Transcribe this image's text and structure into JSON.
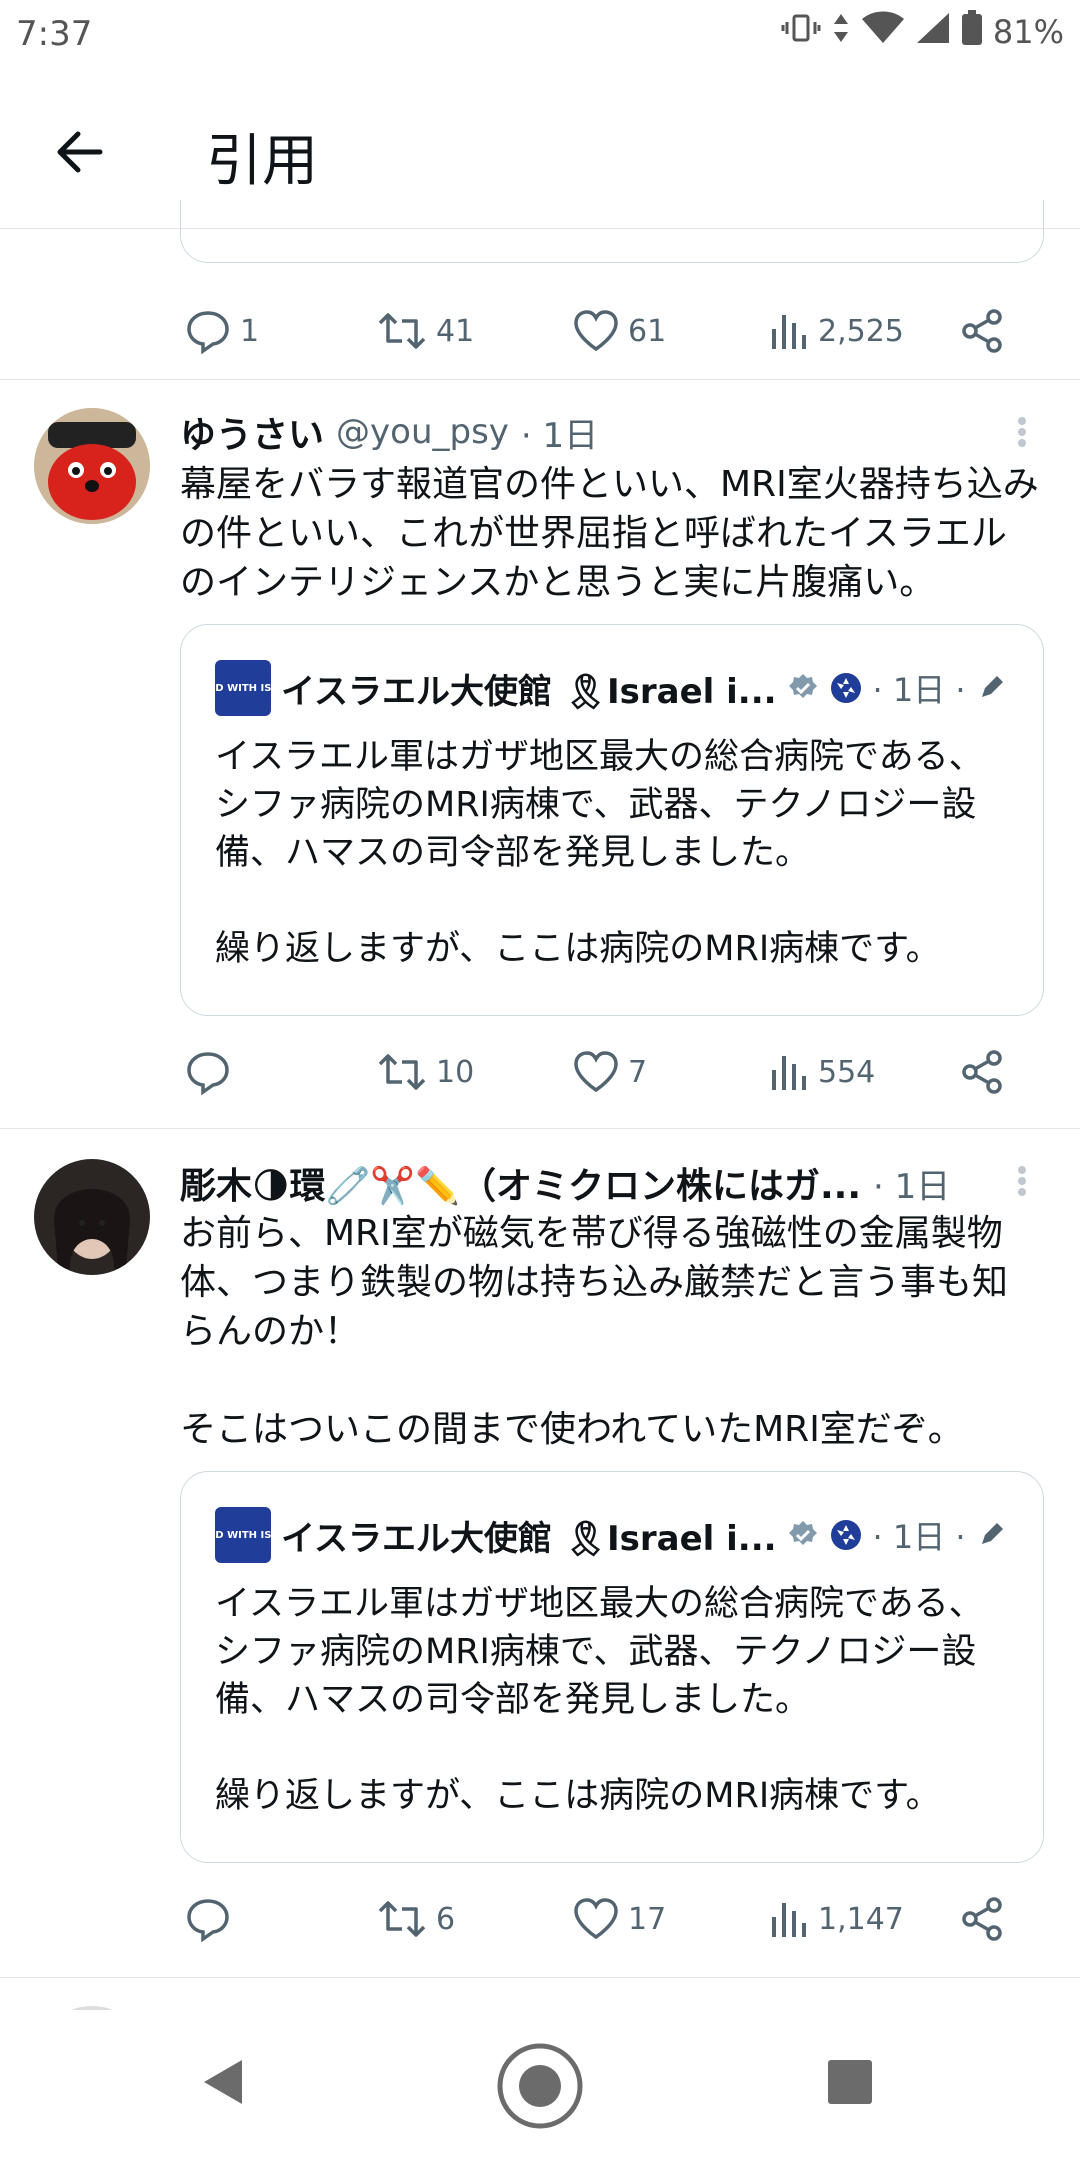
{
  "status_bar": {
    "time": "7:37",
    "battery": "81%"
  },
  "header": {
    "title": "引用"
  },
  "top_actions": {
    "replies": "1",
    "reposts": "41",
    "likes": "61",
    "views": "2,525"
  },
  "posts": [
    {
      "name": "ゆうさい",
      "handle": "@you_psy",
      "time": "· 1日",
      "text": "幕屋をバラす報道官の件といい、MRI室火器持ち込みの件といい、これが世界屈指と呼ばれたイスラエルのインテリジェンスかと思うと実に片腹痛い。",
      "quote": {
        "name": "イスラエル大使館 🎗Israel i...",
        "time": "· 1日 ·",
        "text": "イスラエル軍はガザ地区最大の総合病院である、シファ病院のMRI病棟で、武器、テクノロジー設備、ハマスの司令部を発見しました。\n\n繰り返しますが、ここは病院のMRI病棟です。"
      },
      "actions": {
        "replies": "",
        "reposts": "10",
        "likes": "7",
        "views": "554"
      }
    },
    {
      "name": "彫木🌗環🧷✂️✏️（オミクロン株にはガ...",
      "handle": "",
      "time": "· 1日",
      "text": "お前ら、MRI室が磁気を帯び得る強磁性の金属製物体、つまり鉄製の物は持ち込み厳禁だと言う事も知らんのか！\n\nそこはついこの間まで使われていたMRI室だぞ。",
      "quote": {
        "name": "イスラエル大使館 🎗Israel i...",
        "time": "· 1日 ·",
        "text": "イスラエル軍はガザ地区最大の総合病院である、シファ病院のMRI病棟で、武器、テクノロジー設備、ハマスの司令部を発見しました。\n\n繰り返しますが、ここは病院のMRI病棟です。"
      },
      "actions": {
        "replies": "",
        "reposts": "6",
        "likes": "17",
        "views": "1,147"
      }
    }
  ],
  "quote_logo_text": "STAND WITH ISRAEL",
  "colors": {
    "muted": "#536471",
    "border": "#cfd9de",
    "logo": "#1f3d99"
  }
}
